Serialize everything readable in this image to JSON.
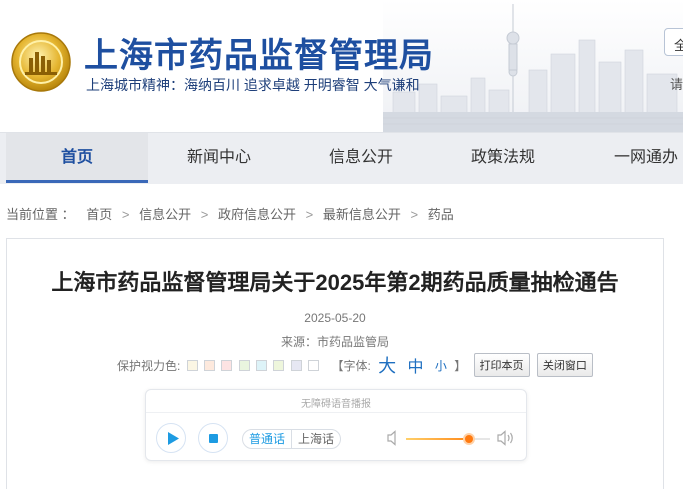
{
  "header": {
    "site_title": "上海市药品监督管理局",
    "motto": "上海城市精神：海纳百川  追求卓越  开明睿智  大气谦和",
    "search_text": "全",
    "login_text": "请"
  },
  "nav": {
    "items": [
      {
        "label": "首页"
      },
      {
        "label": "新闻中心"
      },
      {
        "label": "信息公开"
      },
      {
        "label": "政策法规"
      },
      {
        "label": "一网通办"
      }
    ],
    "active_index": 0
  },
  "breadcrumb": {
    "prefix": "当前位置 ：",
    "items": [
      "首页",
      "信息公开",
      "政府信息公开",
      "最新信息公开",
      "药品"
    ],
    "separator": ">"
  },
  "article": {
    "title": "上海市药品监督管理局关于2025年第2期药品质量抽检通告",
    "date": "2025-05-20",
    "source": "来源：市药品监管局"
  },
  "tools": {
    "eye_color_label": "保护视力色:",
    "eye_colors": [
      "#fbf6e4",
      "#fde9dd",
      "#fde3e3",
      "#e9f5df",
      "#ddf3f8",
      "#eef6dc",
      "#e6e7f3",
      "#ffffff"
    ],
    "font_label": "【字体:",
    "font_big": "大",
    "font_mid": "中",
    "font_small": "小",
    "font_close": "】",
    "print_btn": "打印本页",
    "close_btn": "关闭窗口"
  },
  "player": {
    "caption": "无障碍语音播报",
    "lang_options": [
      "普通话",
      "上海话"
    ],
    "active_lang": 0,
    "volume": 0.75
  },
  "colors": {
    "brand_blue": "#1e4fa0",
    "accent_blue": "#1d9be2",
    "volume_orange": "#ff7a10"
  }
}
